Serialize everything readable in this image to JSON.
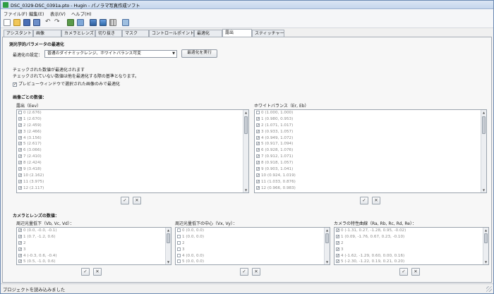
{
  "window": {
    "title": "DSC_0329-DSC_0391a.pto - Hugin - パノラマ写真作成ソフト"
  },
  "menu": [
    "ファイル(F)",
    "編集(E)",
    "表示(V)",
    "ヘルプ(H)"
  ],
  "toolbar": {
    "icons": [
      "new-project-icon",
      "open-project-icon",
      "save-icon",
      "save-as-icon",
      "undo-icon",
      "redo-icon",
      "control-points-icon",
      "add-images-icon",
      "preview-icon",
      "fast-preview-icon",
      "layout-icon",
      "panorama-editor-icon"
    ]
  },
  "tabs": [
    {
      "label": "アシスタント",
      "active": false
    },
    {
      "label": "画像",
      "active": false
    },
    {
      "label": "カメラとレンズ",
      "active": false
    },
    {
      "label": "切り抜き",
      "active": false
    },
    {
      "label": "マスク",
      "active": false
    },
    {
      "label": "コントロールポイント",
      "active": false
    },
    {
      "label": "最適化",
      "active": false
    },
    {
      "label": "露出",
      "active": true
    },
    {
      "label": "スティッチャー",
      "active": false
    }
  ],
  "photometric": {
    "section_title": "測光学的パラメータの最適化",
    "optimize_label": "最適化の設定：",
    "optimize_value": "普通のダイナミックレンジ、ホワイトバランス可変",
    "run_button": "最適化を実行",
    "info_line1": "チェックされた数値が最適化されます",
    "info_line2": "チェックされていない数値は他を最適化する際の基準となります。",
    "preview_only_label": "プレビューウィンドウで選択された画像のみで最適化",
    "preview_only_checked": true
  },
  "per_image": {
    "section_title": "画像ごとの数値：",
    "exposure": {
      "label": "露出（Eev）",
      "rows": [
        {
          "text": "0 (2.676)",
          "checked": false
        },
        {
          "text": "1 (2.670)",
          "checked": true
        },
        {
          "text": "2 (2.459)",
          "checked": true
        },
        {
          "text": "3 (2.466)",
          "checked": true
        },
        {
          "text": "4 (3.156)",
          "checked": true
        },
        {
          "text": "5 (2.617)",
          "checked": true
        },
        {
          "text": "6 (3.066)",
          "checked": true
        },
        {
          "text": "7 (2.410)",
          "checked": true
        },
        {
          "text": "8 (2.424)",
          "checked": true
        },
        {
          "text": "9 (3.418)",
          "checked": true
        },
        {
          "text": "10 (2.162)",
          "checked": true
        },
        {
          "text": "11 (3.975)",
          "checked": true
        },
        {
          "text": "12 (2.117)",
          "checked": true
        }
      ]
    },
    "white_balance": {
      "label": "ホワイトバランス（Er, Eb）",
      "rows": [
        {
          "text": "0 (1.000, 1.000)",
          "checked": false
        },
        {
          "text": "1 (0.980, 0.953)",
          "checked": true
        },
        {
          "text": "2 (1.071, 1.017)",
          "checked": true
        },
        {
          "text": "3 (0.933, 1.057)",
          "checked": true
        },
        {
          "text": "4 (0.949, 1.072)",
          "checked": true
        },
        {
          "text": "5 (0.917, 1.094)",
          "checked": true
        },
        {
          "text": "6 (0.928, 1.076)",
          "checked": true
        },
        {
          "text": "7 (0.912, 1.071)",
          "checked": true
        },
        {
          "text": "8 (0.918, 1.057)",
          "checked": true
        },
        {
          "text": "9 (0.903, 1.041)",
          "checked": true
        },
        {
          "text": "10 (0.924, 1.019)",
          "checked": true
        },
        {
          "text": "11 (1.033, 0.876)",
          "checked": true
        },
        {
          "text": "12 (0.966, 0.983)",
          "checked": true
        }
      ]
    },
    "check_glyph": "✓",
    "clear_glyph": "✕"
  },
  "camera_lens": {
    "section_title": "カメラとレンズの数値：",
    "vignetting": {
      "label": "周辺光量低下（Vb, Vc, Vd）：",
      "rows": [
        {
          "text": "0 (0.0, -0.0, -0.1)",
          "checked": true
        },
        {
          "text": "1 (0.7, -1.2, 0.6)",
          "checked": true
        },
        {
          "text": "2",
          "checked": true
        },
        {
          "text": "3",
          "checked": true
        },
        {
          "text": "4 (-0.3, 0.6, -0.4)",
          "checked": true
        },
        {
          "text": "5 (0.5, -1.0, 0.6)",
          "checked": true
        }
      ]
    },
    "vignetting_center": {
      "label": "周辺光量低下の中心（Vx, Vy）：",
      "rows": [
        {
          "text": "0 (0.0, 0.0)",
          "checked": false
        },
        {
          "text": "1 (0.0, 0.0)",
          "checked": false
        },
        {
          "text": "2",
          "checked": false
        },
        {
          "text": "3",
          "checked": false
        },
        {
          "text": "4 (0.0, 0.0)",
          "checked": false
        },
        {
          "text": "5 (0.0, 0.0)",
          "checked": false
        }
      ]
    },
    "response": {
      "label": "カメラの特性曲線（Ra, Rb, Rc, Rd, Re）：",
      "rows": [
        {
          "text": "0 (-1.31, 0.27, -1.28, 0.95, -0.02)",
          "checked": true
        },
        {
          "text": "1 (0.09, -1.76, 0.67, 0.23, -0.10)",
          "checked": true
        },
        {
          "text": "2",
          "checked": true
        },
        {
          "text": "3",
          "checked": true
        },
        {
          "text": "4 (-1.62, -1.29, 0.60, 0.00, 0.16)",
          "checked": true
        },
        {
          "text": "5 (-2.30, -1.22, 0.19, 0.21, 0.20)",
          "checked": true
        }
      ]
    }
  },
  "status": {
    "text": "プロジェクトを読み込みました"
  },
  "colors": {
    "accent": "#2f9e44",
    "titlebar": "#c5d6ec"
  }
}
